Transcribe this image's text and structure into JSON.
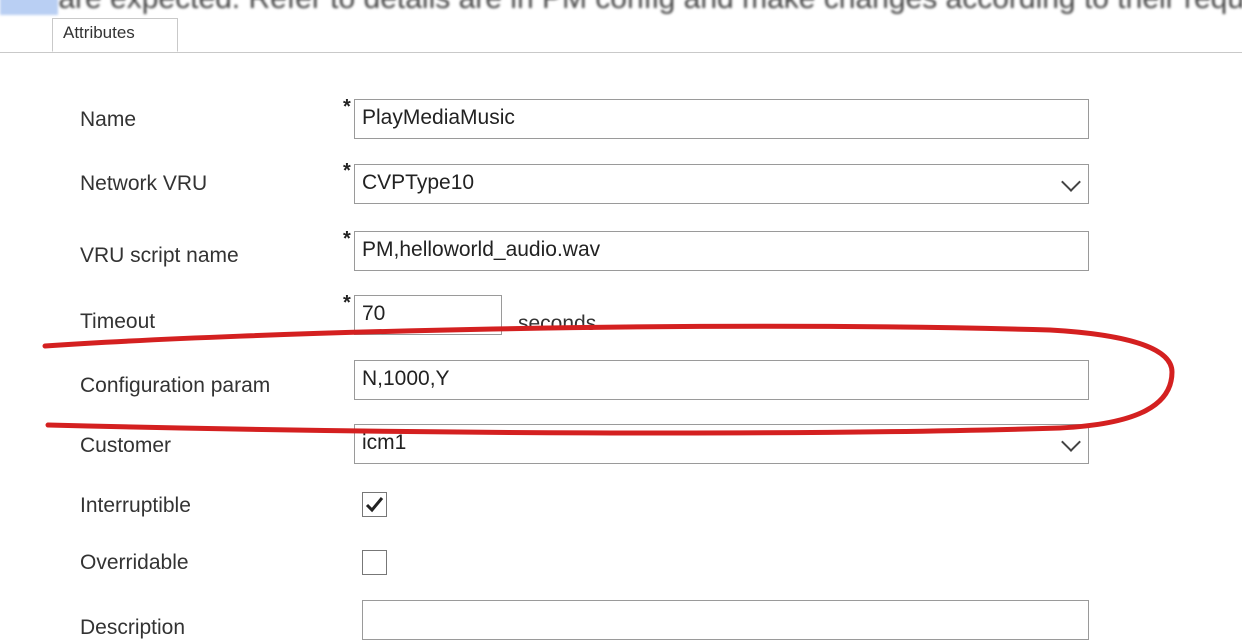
{
  "banner_text": "are expected. Refer to details are in PM config and make changes according to their requi",
  "tabs": [
    {
      "label": "Attributes"
    }
  ],
  "form": {
    "name": {
      "label": "Name",
      "value": "PlayMediaMusic",
      "required_mark": "*"
    },
    "network_vru": {
      "label": "Network VRU",
      "value": "CVPType10",
      "required_mark": "*"
    },
    "vru_script_name": {
      "label": "VRU script name",
      "value": "PM,helloworld_audio.wav",
      "required_mark": "*"
    },
    "timeout": {
      "label": "Timeout",
      "value": "70",
      "unit": "seconds",
      "required_mark": "*"
    },
    "configuration_param": {
      "label": "Configuration param",
      "value": "N,1000,Y"
    },
    "customer": {
      "label": "Customer",
      "value": "icm1"
    },
    "interruptible": {
      "label": "Interruptible",
      "checked": true
    },
    "overridable": {
      "label": "Overridable",
      "checked": false
    },
    "description": {
      "label": "Description",
      "value": ""
    }
  },
  "annotation_color": "#d42020"
}
